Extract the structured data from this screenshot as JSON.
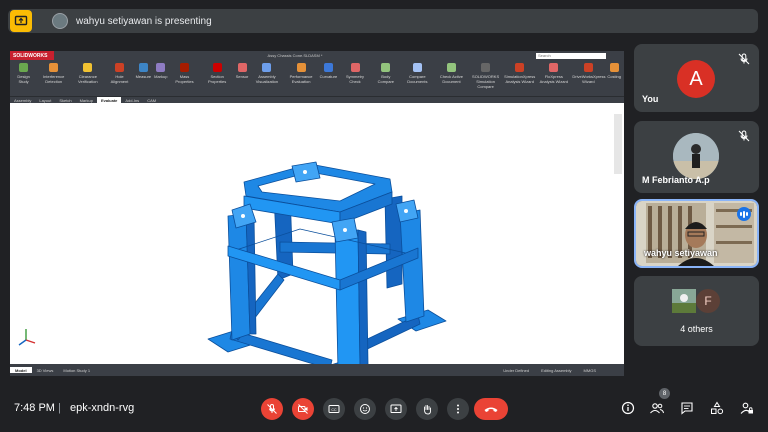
{
  "banner": {
    "text": "wahyu setiyawan is presenting"
  },
  "shared_screen": {
    "app_logo": "SOLIDWORKS",
    "window_title": "Assy Chassis Cone.SLDASM *",
    "search_placeholder": "Search",
    "ribbon": [
      {
        "label": "Design Study",
        "color": "#6aa84f"
      },
      {
        "label": "Interference Detection",
        "color": "#e69138"
      },
      {
        "label": "Clearance Verification",
        "color": "#f1c232"
      },
      {
        "label": "Hole Alignment",
        "color": "#cc4125"
      },
      {
        "label": "Measure",
        "color": "#3d85c6"
      },
      {
        "label": "Markup",
        "color": "#8e7cc3"
      },
      {
        "label": "Mass Properties",
        "color": "#a61c00"
      },
      {
        "label": "Section Properties",
        "color": "#cc0000"
      },
      {
        "label": "Sensor",
        "color": "#e06666"
      },
      {
        "label": "Assembly Visualization",
        "color": "#6d9eeb"
      },
      {
        "label": "Performance Evaluation",
        "color": "#e69138"
      },
      {
        "label": "Curvature",
        "color": "#3c78d8"
      },
      {
        "label": "Symmetry Check",
        "color": "#e06666"
      },
      {
        "label": "Body Compare",
        "color": "#93c47d"
      },
      {
        "label": "Compare Documents",
        "color": "#a4c2f4"
      },
      {
        "label": "Check Active Document",
        "color": "#93c47d"
      },
      {
        "label": "SOLIDWORKS Simulation Compare",
        "color": "#666666"
      },
      {
        "label": "SimulationXpress Analysis Wizard",
        "color": "#cc4125"
      },
      {
        "label": "FloXpress Analysis Wizard",
        "color": "#e06666"
      },
      {
        "label": "DriveWorksXpress Wizard",
        "color": "#cc4125"
      },
      {
        "label": "Costing",
        "color": "#e69138"
      }
    ],
    "tabs": [
      "Assembly",
      "Layout",
      "Sketch",
      "Markup",
      "Evaluate",
      "Add-Ins",
      "CAM"
    ],
    "active_tab": "Evaluate",
    "bottom_tabs": [
      "Model",
      "3D Views",
      "Motion Study 1"
    ],
    "active_bottom_tab": "Model",
    "status": [
      "Under Defined",
      "Editing Assembly",
      "MMGS"
    ],
    "model_color": "#1e88e5"
  },
  "participants": [
    {
      "name": "You",
      "initial": "A",
      "muted": true
    },
    {
      "name": "M Febrianto A.p",
      "muted": true
    },
    {
      "name": "wahyu setiyawan",
      "speaking": true
    },
    {
      "label": "4 others",
      "initial": "F"
    }
  ],
  "meeting": {
    "time": "7:48 PM",
    "separator": "|",
    "code": "epk-xndn-rvg",
    "people_count": "8"
  },
  "controls": [
    "mic-off",
    "camera-off",
    "captions",
    "emoji",
    "present",
    "raise-hand",
    "more",
    "end-call"
  ],
  "right_controls": [
    "info",
    "people",
    "chat",
    "activities",
    "host-controls"
  ]
}
